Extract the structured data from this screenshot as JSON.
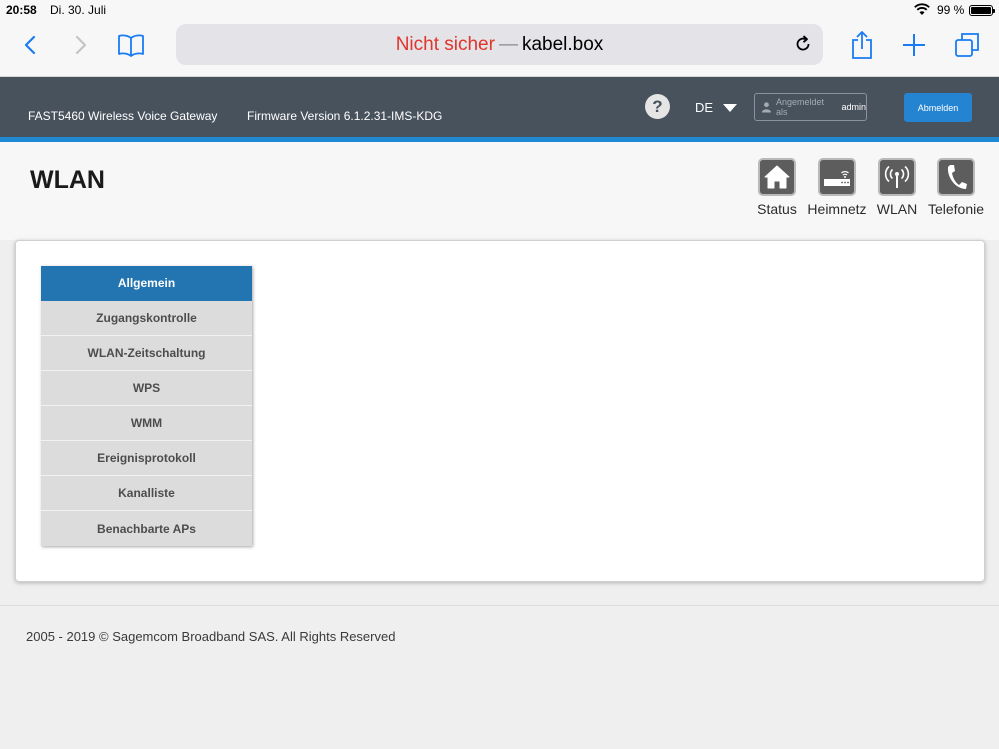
{
  "status_bar": {
    "time": "20:58",
    "date": "Di. 30. Juli",
    "battery": "99 %",
    "wifi_icon": "wifi-icon",
    "battery_icon": "battery-icon"
  },
  "browser": {
    "url_warning": "Nicht sicher",
    "url_separator": "—",
    "url_host": "kabel.box",
    "icons": [
      "back-icon",
      "forward-icon",
      "bookmarks-icon",
      "reload-icon",
      "share-icon",
      "new-tab-icon",
      "tabs-icon"
    ]
  },
  "router_header": {
    "model": "FAST5460 Wireless Voice Gateway",
    "firmware": "Firmware Version 6.1.2.31-IMS-KDG",
    "help_label": "?",
    "language": "DE",
    "login_placeholder": "Angemeldet als",
    "login_user": "admin",
    "logout_label": "Abmelden",
    "accent_color": "#1f8ad1",
    "header_color": "#48525d"
  },
  "page": {
    "title": "WLAN",
    "nav": [
      {
        "label": "Status",
        "icon": "home-icon"
      },
      {
        "label": "Heimnetz",
        "icon": "router-icon"
      },
      {
        "label": "WLAN",
        "icon": "wifi-antenna-icon"
      },
      {
        "label": "Telefonie",
        "icon": "phone-icon"
      }
    ]
  },
  "side_menu": {
    "active_color": "#2275b0",
    "items": [
      {
        "label": "Allgemein",
        "active": true
      },
      {
        "label": "Zugangskontrolle"
      },
      {
        "label": "WLAN-Zeitschaltung"
      },
      {
        "label": "WPS"
      },
      {
        "label": "WMM"
      },
      {
        "label": "Ereignisprotokoll"
      },
      {
        "label": "Kanalliste"
      },
      {
        "label": "Benachbarte APs"
      }
    ]
  },
  "footer": {
    "copyright": "2005 - 2019 © Sagemcom Broadband SAS. All Rights Reserved"
  }
}
